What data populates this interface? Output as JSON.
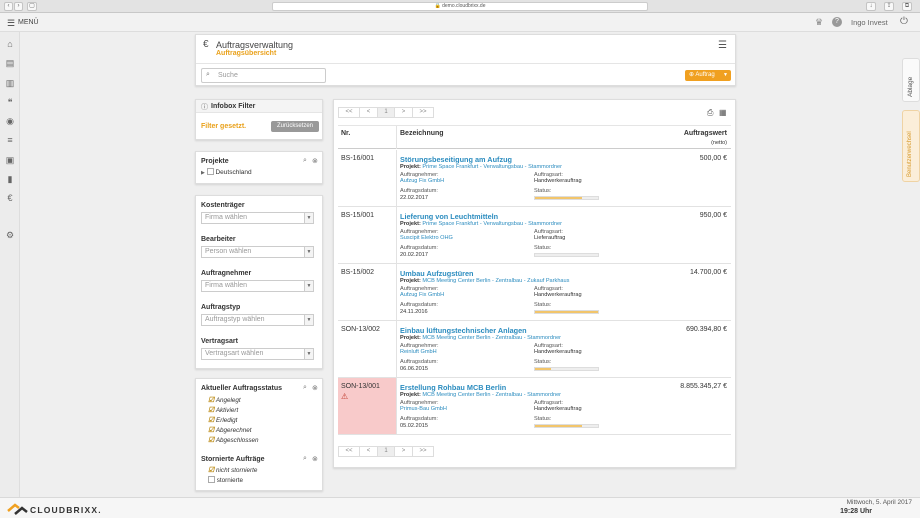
{
  "browser": {
    "url": "demo.cloudbrixx.de"
  },
  "topbar": {
    "menu_label": "MENÜ",
    "user_name": "Ingo Invest"
  },
  "header": {
    "title": "Auftragsverwaltung",
    "subtitle": "Auftragsübersicht",
    "search_placeholder": "Suche",
    "add_button": "Auftrag"
  },
  "infobox": {
    "title": "Infobox Filter",
    "status": "Filter gesetzt.",
    "reset_button": "Zurücksetzen"
  },
  "projekte": {
    "title": "Projekte",
    "item": "Deutschland"
  },
  "filters": [
    {
      "label": "Kostenträger",
      "placeholder": "Firma wählen"
    },
    {
      "label": "Bearbeiter",
      "placeholder": "Person wählen"
    },
    {
      "label": "Auftragnehmer",
      "placeholder": "Firma wählen"
    },
    {
      "label": "Auftragstyp",
      "placeholder": "Auftragstyp wählen"
    },
    {
      "label": "Vertragsart",
      "placeholder": "Vertragsart wählen"
    }
  ],
  "status_filter": {
    "title": "Aktueller Auftragsstatus",
    "items": [
      "Angelegt",
      "Aktiviert",
      "Erledigt",
      "Abgerechnet",
      "Abgeschlossen"
    ]
  },
  "storno_filter": {
    "title": "Stornierte Aufträge",
    "items": [
      "nicht stornierte",
      "stornierte"
    ]
  },
  "pagination": {
    "first": "<<",
    "prev": "<",
    "page": "1",
    "next": ">",
    "last": ">>"
  },
  "table": {
    "col_nr": "Nr.",
    "col_desc": "Bezeichnung",
    "col_value": "Auftragswert",
    "col_value_sub": "(netto)",
    "k_project": "Projekt:",
    "k_contractor": "Auftragnehmer:",
    "k_type": "Auftragsart:",
    "k_date": "Auftragsdatum:",
    "k_status": "Status:",
    "rows": [
      {
        "nr": "BS-16/001",
        "title": "Störungsbeseitigung am Aufzug",
        "project": "Prime Space Frankfurt - Verwaltungsbau - Stammordner",
        "contractor": "Aufzug Fix GmbH",
        "type": "Handwerkerauftrag",
        "date": "22.02.2017",
        "value": "500,00 €",
        "progress": 0.75
      },
      {
        "nr": "BS-15/001",
        "title": "Lieferung von Leuchtmitteln",
        "project": "Prime Space Frankfurt - Verwaltungsbau - Stammordner",
        "contractor": "Suscipit Elektro OHG",
        "type": "Lieferauftrag",
        "date": "20.02.2017",
        "value": "950,00 €",
        "progress": 0.0
      },
      {
        "nr": "BS-15/002",
        "title": "Umbau Aufzugstüren",
        "project": "MCB Meeting Center Berlin - Zentralbau - Zukauf Parkhaus",
        "contractor": "Aufzug Fix GmbH",
        "type": "Handwerkerauftrag",
        "date": "24.11.2016",
        "value": "14.700,00 €",
        "progress": 1.0
      },
      {
        "nr": "SON-13/002",
        "title": "Einbau lüftungstechnischer Anlagen",
        "project": "MCB Meeting Center Berlin - Zentralbau - Stammordner",
        "contractor": "Reinluft GmbH",
        "type": "Handwerkerauftrag",
        "date": "06.06.2015",
        "value": "690.394,80 €",
        "progress": 0.25
      },
      {
        "nr": "SON-13/001",
        "title": "Erstellung Rohbau MCB Berlin",
        "project": "MCB Meeting Center Berlin - Zentralbau - Stammordner",
        "contractor": "Primus-Bau GmbH",
        "type": "Handwerkerauftrag",
        "date": "05.02.2015",
        "value": "8.855.345,27 €",
        "progress": 0.75,
        "warning": true
      }
    ]
  },
  "side_tabs": {
    "ablage": "Ablage",
    "notes": "Benutzerwechsel"
  },
  "footer": {
    "logo": "CLOUDBRIXX.",
    "date": "Mittwoch, 5. April 2017",
    "time": "19:28 Uhr"
  },
  "colors": {
    "accent": "#f0a020",
    "link": "#2b8cbf",
    "warning_row": "#f8caca",
    "progress": "#f2c56b"
  }
}
